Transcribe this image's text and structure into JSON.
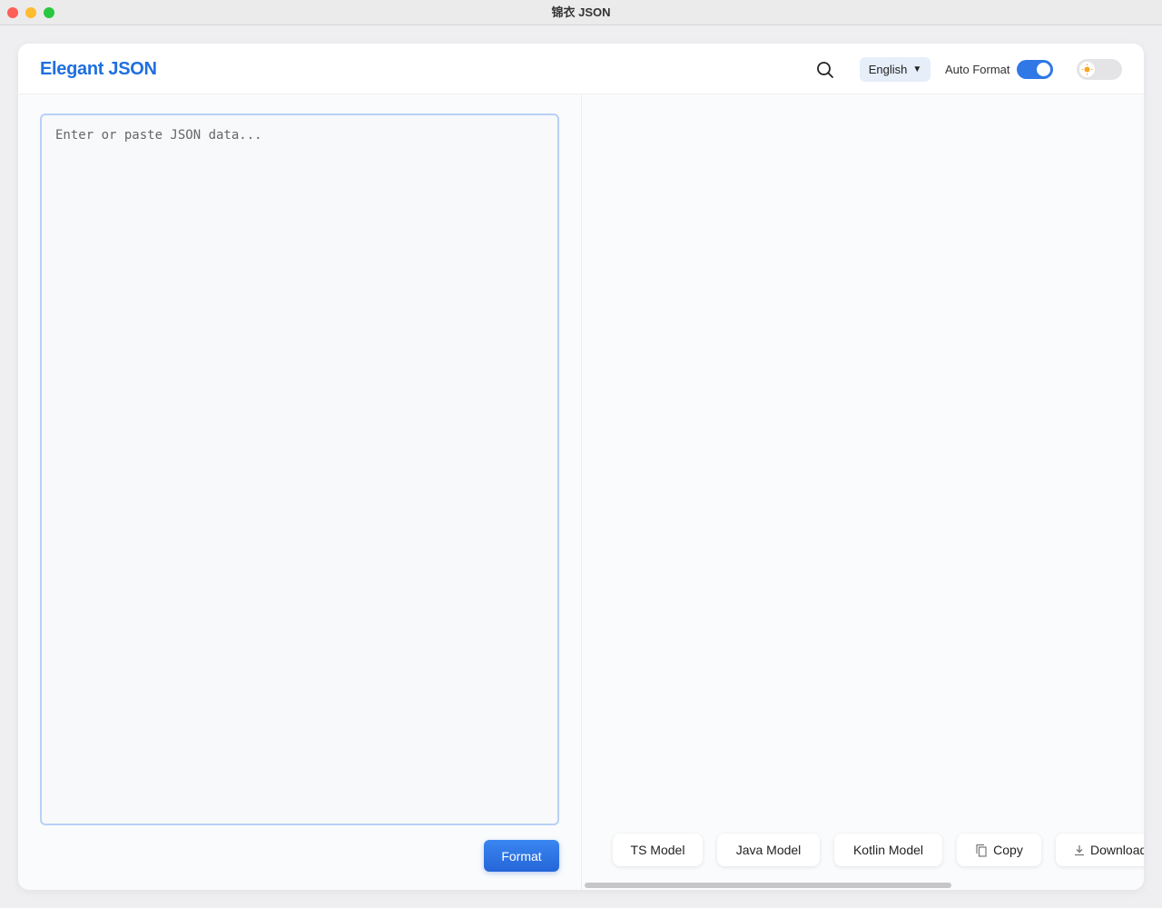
{
  "window": {
    "title": "锦衣 JSON"
  },
  "header": {
    "logo": "Elegant JSON",
    "language": "English",
    "auto_format_label": "Auto Format",
    "auto_format_on": true,
    "theme": "light"
  },
  "editor": {
    "placeholder": "Enter or paste JSON data...",
    "value": "",
    "format_label": "Format"
  },
  "output": {
    "buttons": [
      {
        "label": "TS Model"
      },
      {
        "label": "Java Model"
      },
      {
        "label": "Kotlin Model"
      },
      {
        "label": "Copy"
      },
      {
        "label": "Download"
      }
    ]
  },
  "colors": {
    "accent": "#2f78e6",
    "logo": "#1f6fe0"
  }
}
